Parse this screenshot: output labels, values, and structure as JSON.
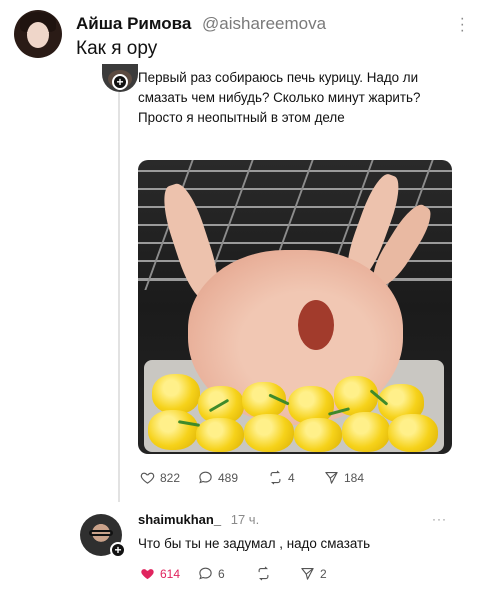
{
  "outer_post": {
    "author_name": "Айша Римова",
    "author_handle": "@aishareemova",
    "text": "Как я ору",
    "menu_icon": "vertical-dots-icon"
  },
  "quoted_post": {
    "text": "Первый раз собираюсь печь курицу. Надо ли смазать чем нибудь? Сколько минут жарить? Просто я неопытный в этом деле",
    "image_description_icon": "photo",
    "stats": {
      "likes": "822",
      "replies": "489",
      "reposts": "4",
      "shares": "184"
    }
  },
  "reply": {
    "username": "shaimukhan_",
    "time": "17 ч.",
    "menu": "···",
    "text": "Что бы ты не задумал , надо смазать",
    "stats": {
      "likes": "614",
      "replies": "6",
      "reposts": "",
      "shares": "2"
    },
    "liked": true
  },
  "colors": {
    "like_active": "#e0245e",
    "muted": "#7a7a7a",
    "thread_line": "#e2e2e2"
  }
}
